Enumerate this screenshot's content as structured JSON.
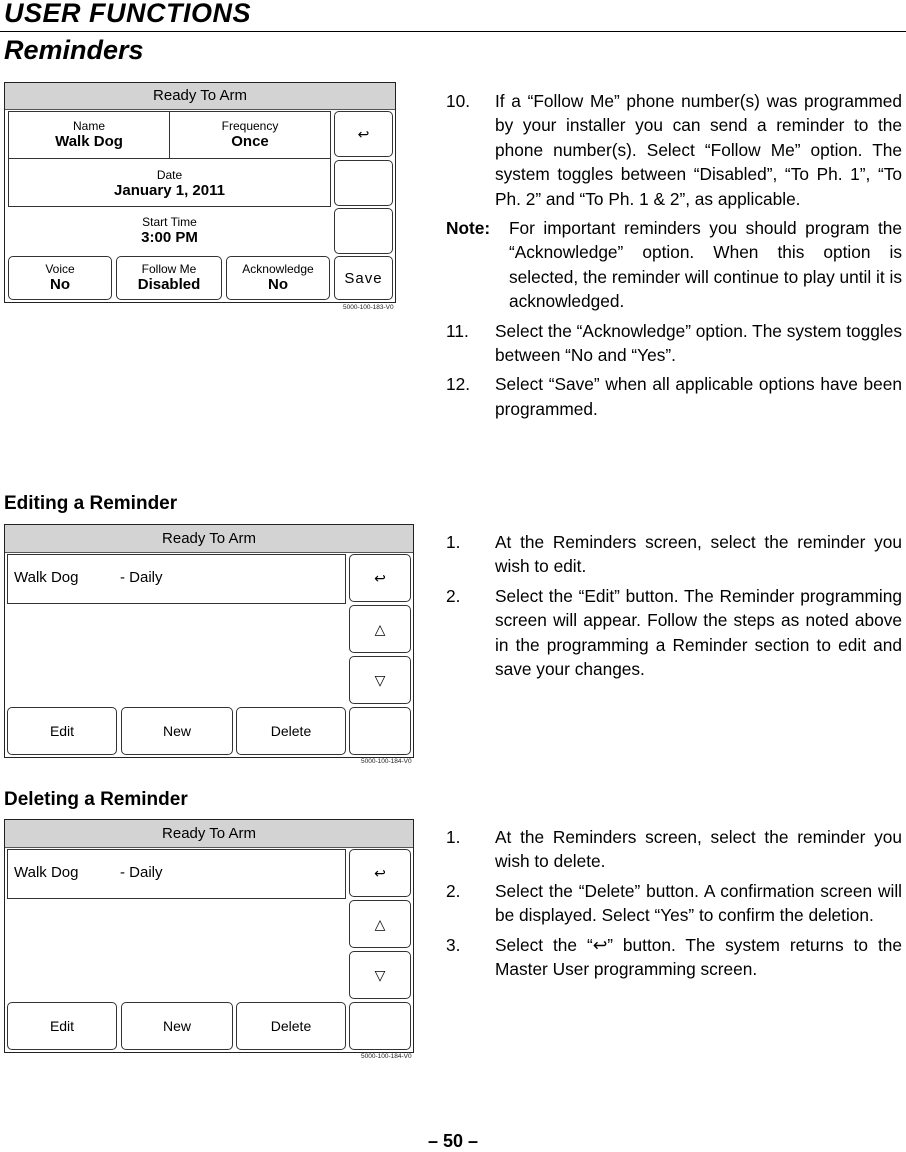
{
  "header": {
    "chapter_title": "USER FUNCTIONS",
    "section_title": "Reminders"
  },
  "panel1": {
    "status_bar": "Ready To Arm",
    "name_label": "Name",
    "name_value": "Walk Dog",
    "frequency_label": "Frequency",
    "frequency_value": "Once",
    "date_label": "Date",
    "date_value": "January 1, 2011",
    "start_time_label": "Start Time",
    "start_time_value": "3:00 PM",
    "voice_label": "Voice",
    "voice_value": "No",
    "follow_me_label": "Follow Me",
    "follow_me_value": "Disabled",
    "acknowledge_label": "Acknowledge",
    "acknowledge_value": "No",
    "back_icon": "↩",
    "save_label": "Save",
    "figure_code": "5000-100-183-V0"
  },
  "steps_programming": [
    {
      "num": "10.",
      "text": "If a “Follow Me” phone number(s) was programmed by your installer you can send a reminder to the phone number(s). Select “Follow Me” option. The system toggles between “Disabled”, “To Ph. 1”, “To Ph. 2” and “To Ph. 1 & 2”, as applicable."
    },
    {
      "num": "Note:",
      "text": "For important reminders you should program the “Acknowledge” option. When this option is selected, the reminder will continue to play until it is acknowledged."
    },
    {
      "num": "11.",
      "text": "Select the “Acknowledge” option. The system toggles between “No and “Yes”."
    },
    {
      "num": "12.",
      "text": "Select “Save” when all applicable options have been programmed."
    }
  ],
  "editing": {
    "title": "Editing a Reminder",
    "panel": {
      "status_bar": "Ready To Arm",
      "row_name": "Walk Dog",
      "row_freq": "- Daily",
      "back_icon": "↩",
      "up_icon": "△",
      "down_icon": "▽",
      "edit_label": "Edit",
      "new_label": "New",
      "delete_label": "Delete",
      "figure_code": "5000-100-184-V0"
    },
    "steps": [
      {
        "num": "1.",
        "text": "At the Reminders screen, select the reminder you wish to edit."
      },
      {
        "num": "2.",
        "text": "Select the “Edit” button. The Reminder programming screen will appear. Follow the steps as noted above in the programming a Reminder section to edit and save your changes."
      }
    ]
  },
  "deleting": {
    "title": "Deleting a Reminder",
    "panel": {
      "status_bar": "Ready To Arm",
      "row_name": "Walk Dog",
      "row_freq": "- Daily",
      "back_icon": "↩",
      "up_icon": "△",
      "down_icon": "▽",
      "edit_label": "Edit",
      "new_label": "New",
      "delete_label": "Delete",
      "figure_code": "5000-100-184-V0"
    },
    "steps": [
      {
        "num": "1.",
        "text": "At the Reminders screen, select the reminder you wish to delete."
      },
      {
        "num": "2.",
        "text": "Select the “Delete” button. A confirmation screen will be displayed. Select “Yes” to confirm the deletion."
      },
      {
        "num": "3.",
        "text": "Select the “↩” button. The system returns to the Master User programming screen."
      }
    ]
  },
  "footer": {
    "page_number": "– 50 –"
  }
}
